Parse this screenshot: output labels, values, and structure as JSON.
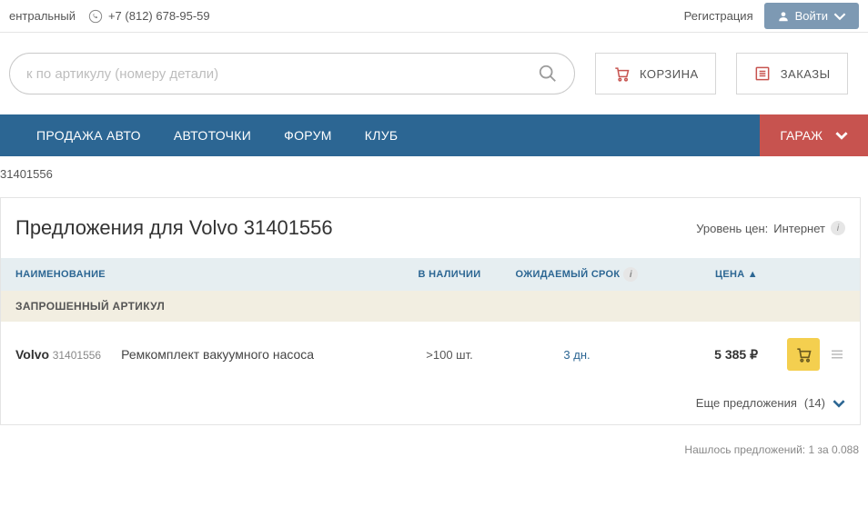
{
  "topbar": {
    "region_fragment": "ентральный",
    "phone": "+7 (812) 678-95-59",
    "register": "Регистрация",
    "login": "Войти"
  },
  "search": {
    "placeholder": "к по артикулу (номеру детали)"
  },
  "buttons": {
    "cart": "КОРЗИНА",
    "orders": "ЗАКАЗЫ"
  },
  "nav": {
    "sell": "ПРОДАЖА АВТО",
    "points": "АВТОТОЧКИ",
    "forum": "ФОРУМ",
    "club": "КЛУБ",
    "garage": "ГАРАЖ"
  },
  "breadcrumb": "31401556",
  "panel": {
    "title": "Предложения для Volvo 31401556",
    "price_level_label": "Уровень цен:",
    "price_level_value": "Интернет"
  },
  "columns": {
    "name": "НАИМЕНОВАНИЕ",
    "stock": "В НАЛИЧИИ",
    "date": "ОЖИДАЕМЫЙ СРОК",
    "price": "ЦЕНА ▲"
  },
  "section_label": "ЗАПРОШЕННЫЙ АРТИКУЛ",
  "row": {
    "brand": "Volvo",
    "article": "31401556",
    "desc": "Ремкомплект вакуумного насоса",
    "stock": ">100 шт.",
    "date": "3 дн.",
    "price": "5 385 ₽"
  },
  "more": {
    "label": "Еще предложения",
    "count": "(14)"
  },
  "footnote": "Нашлось предложений: 1 за 0.088"
}
